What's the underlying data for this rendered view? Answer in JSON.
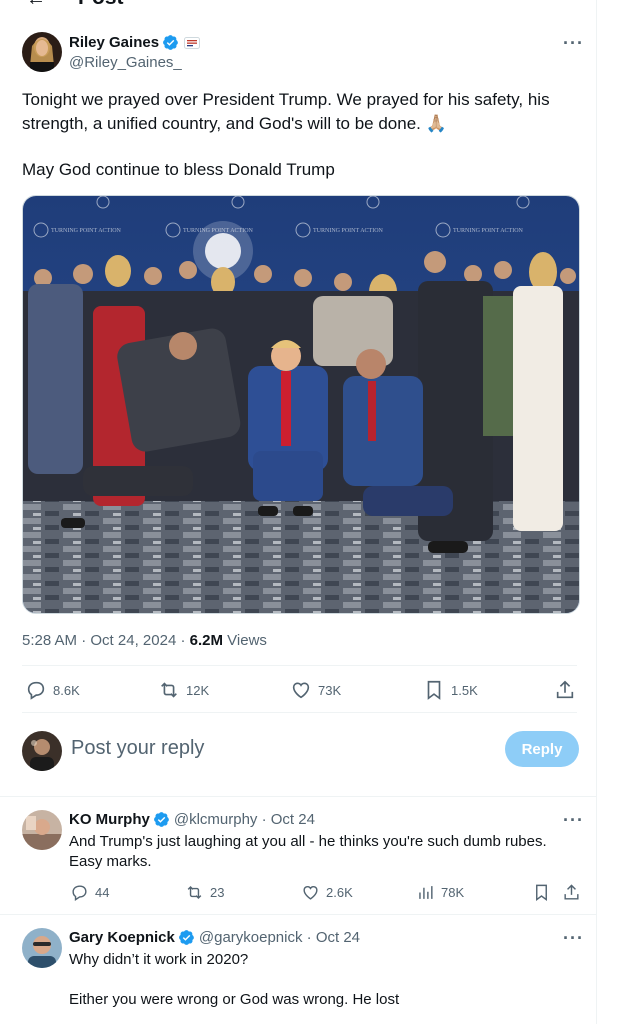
{
  "header": {
    "back_glyph": "←",
    "title": "Post"
  },
  "post": {
    "author": {
      "name": "Riley Gaines",
      "handle": "@Riley_Gaines_",
      "affiliate_badge": "flag-badge"
    },
    "text_line1": "Tonight we prayed over President Trump. We prayed for his safety, his strength, a unified country, and God's will to be done. 🙏🏼",
    "text_line2": "May God continue to bless Donald Trump",
    "photo_banner_text": "TURNING POINT ACTION",
    "time": "5:28 AM",
    "dot1": "·",
    "date": "Oct 24, 2024",
    "dot2": "·",
    "views_count": "6.2M",
    "views_label": "Views",
    "stats": {
      "replies": "8.6K",
      "reposts": "12K",
      "likes": "73K",
      "bookmarks": "1.5K"
    }
  },
  "composer": {
    "placeholder": "Post your reply",
    "button": "Reply"
  },
  "replies": [
    {
      "name": "KO Murphy",
      "handle": "@klcmurphy · Oct 24",
      "text": "And Trump's just laughing at you all - he thinks you're such dumb rubes. Easy marks.",
      "stats": {
        "replies": "44",
        "reposts": "23",
        "likes": "2.6K",
        "views": "78K"
      }
    },
    {
      "name": "Gary Koepnick",
      "handle": "@garykoepnick · Oct 24",
      "text_line1": "Why didn’t it work in 2020?",
      "text_line2": "Either you were wrong or God was wrong. He lost"
    }
  ],
  "more_glyph": "···",
  "colors": {
    "accent": "#1d9bf0",
    "muted": "#536471",
    "reply_button": "#8ecdf7"
  }
}
